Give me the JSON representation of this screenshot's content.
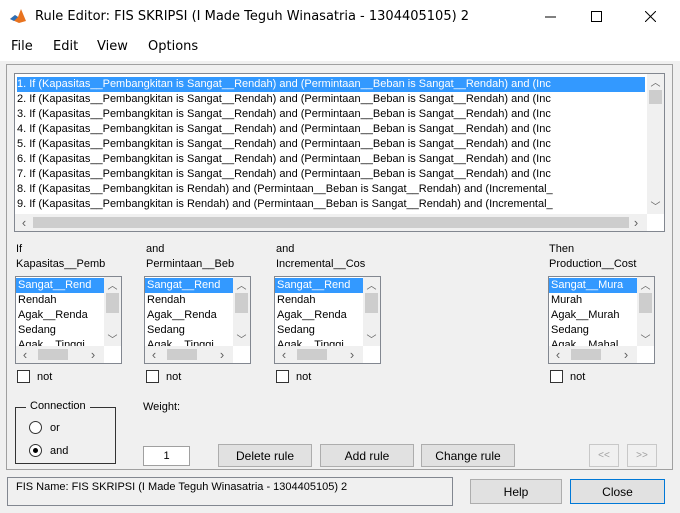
{
  "window": {
    "title": "Rule Editor: FIS SKRIPSI (I Made Teguh Winasatria - 1304405105) 2",
    "minimize_glyph": "─",
    "maximize_glyph": "☐",
    "close_glyph": "✕"
  },
  "menu": {
    "items": [
      "File",
      "Edit",
      "View",
      "Options"
    ]
  },
  "rules": [
    "1. If (Kapasitas__Pembangkitan is Sangat__Rendah) and (Permintaan__Beban is Sangat__Rendah) and (Inc",
    "2. If (Kapasitas__Pembangkitan is Sangat__Rendah) and (Permintaan__Beban is Sangat__Rendah) and (Inc",
    "3. If (Kapasitas__Pembangkitan is Sangat__Rendah) and (Permintaan__Beban is Sangat__Rendah) and (Inc",
    "4. If (Kapasitas__Pembangkitan is Sangat__Rendah) and (Permintaan__Beban is Sangat__Rendah) and (Inc",
    "5. If (Kapasitas__Pembangkitan is Sangat__Rendah) and (Permintaan__Beban is Sangat__Rendah) and (Inc",
    "6. If (Kapasitas__Pembangkitan is Sangat__Rendah) and (Permintaan__Beban is Sangat__Rendah) and (Inc",
    "7. If (Kapasitas__Pembangkitan is Sangat__Rendah) and (Permintaan__Beban is Sangat__Rendah) and (Inc",
    "8. If (Kapasitas__Pembangkitan is Rendah) and (Permintaan__Beban is Sangat__Rendah) and (Incremental_",
    "9. If (Kapasitas__Pembangkitan is Rendah) and (Permintaan__Beban is Sangat__Rendah) and (Incremental_"
  ],
  "columns": [
    {
      "prefix": "If",
      "name": "Kapasitas__Pemb",
      "items": [
        "Sangat__Rend",
        "Rendah",
        "Agak__Renda",
        "Sedang",
        "Agak__Tinggi"
      ],
      "not_label": "not"
    },
    {
      "prefix": "and",
      "name": "Permintaan__Beb",
      "items": [
        "Sangat__Rend",
        "Rendah",
        "Agak__Renda",
        "Sedang",
        "Agak__Tinggi"
      ],
      "not_label": "not"
    },
    {
      "prefix": "and",
      "name": "Incremental__Cos",
      "items": [
        "Sangat__Rend",
        "Rendah",
        "Agak__Renda",
        "Sedang",
        "Agak__Tinggi"
      ],
      "not_label": "not"
    },
    {
      "prefix": "Then",
      "name": "Production__Cost",
      "items": [
        "Sangat__Mura",
        "Murah",
        "Agak__Murah",
        "Sedang",
        "Agak__Mahal"
      ],
      "not_label": "not"
    }
  ],
  "connection": {
    "label": "Connection",
    "options": [
      "or",
      "and"
    ],
    "selected": "and"
  },
  "weight": {
    "label": "Weight:",
    "value": "1"
  },
  "buttons": {
    "delete": "Delete rule",
    "add": "Add rule",
    "change": "Change rule",
    "prev": "<<",
    "next": ">>",
    "help": "Help",
    "close": "Close"
  },
  "status": {
    "text": "FIS Name: FIS SKRIPSI (I Made Teguh Winasatria - 1304405105) 2"
  },
  "colors": {
    "selection": "#3399ff",
    "window_bg": "#f0f0f0"
  }
}
